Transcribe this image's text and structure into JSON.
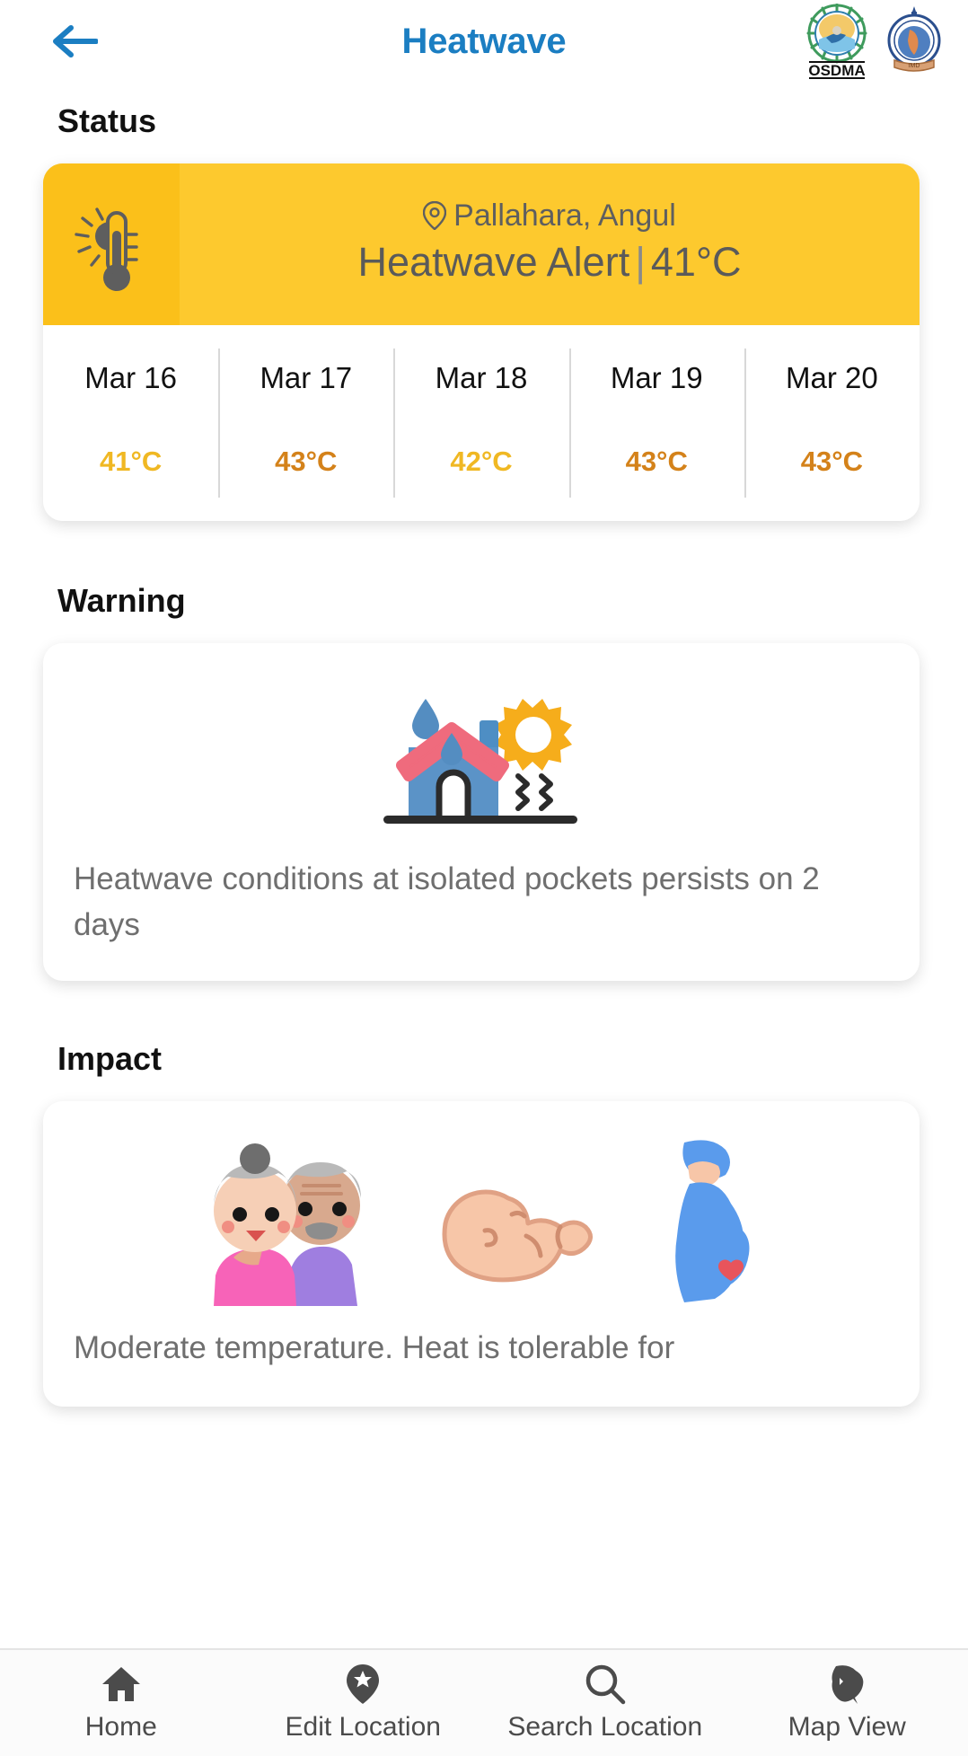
{
  "header": {
    "title": "Heatwave",
    "back_icon": "arrow-left-icon",
    "accent_color": "#1b7ec2",
    "logos": [
      {
        "name": "osdma-logo",
        "caption": "OSDMA"
      },
      {
        "name": "imd-logo",
        "caption": ""
      }
    ]
  },
  "sections": {
    "status_title": "Status",
    "warning_title": "Warning",
    "impact_title": "Impact"
  },
  "status": {
    "alert_icon": "thermometer-sun-icon",
    "location_icon": "location-pin-icon",
    "location": "Pallahara, Angul",
    "alert_label": "Heatwave Alert",
    "separator": "|",
    "alert_temp": "41°C",
    "banner_color": "#fdc92e",
    "banner_icon_color": "#fbc01a",
    "forecast": [
      {
        "date": "Mar 16",
        "temp": "41°C",
        "color": "#f0b823"
      },
      {
        "date": "Mar 17",
        "temp": "43°C",
        "color": "#d4821a"
      },
      {
        "date": "Mar 18",
        "temp": "42°C",
        "color": "#f0b823"
      },
      {
        "date": "Mar 19",
        "temp": "43°C",
        "color": "#d4821a"
      },
      {
        "date": "Mar 20",
        "temp": "43°C",
        "color": "#d4821a"
      }
    ]
  },
  "warning": {
    "illustration": "house-heat-sun-icon",
    "text": "Heatwave conditions at isolated pockets persists on 2 days"
  },
  "impact": {
    "illustrations": [
      "elderly-couple-icon",
      "baby-icon",
      "pregnant-woman-icon"
    ],
    "text": "Moderate temperature. Heat is tolerable for"
  },
  "bottom_nav": [
    {
      "label": "Home",
      "icon": "home-icon"
    },
    {
      "label": "Edit Location",
      "icon": "map-pin-star-icon"
    },
    {
      "label": "Search Location",
      "icon": "search-icon"
    },
    {
      "label": "Map View",
      "icon": "odisha-map-icon"
    }
  ]
}
